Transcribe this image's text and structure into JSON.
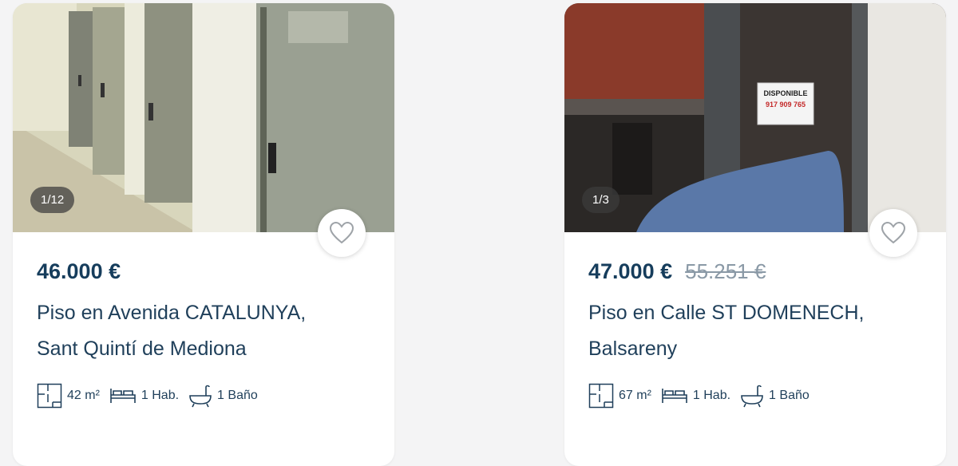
{
  "listings": [
    {
      "photo_counter": "1/12",
      "price": "46.000 €",
      "old_price": "",
      "title_line1": "Piso en Avenida CATALUNYA,",
      "title_line2": "Sant Quintí de Mediona",
      "area": "42 m²",
      "rooms": "1 Hab.",
      "baths": "1 Baño",
      "icons": [
        "floorplan-icon",
        "bed-icon",
        "bathtub-icon",
        "heart-icon"
      ]
    },
    {
      "photo_counter": "1/3",
      "price": "47.000 €",
      "old_price": "55.251 €",
      "title_line1": "Piso en Calle ST DOMENECH,",
      "title_line2": "Balsareny",
      "area": "67 m²",
      "rooms": "1 Hab.",
      "baths": "1 Baño",
      "sign_line1": "DISPONIBLE",
      "sign_line2": "917 909 765",
      "icons": [
        "floorplan-icon",
        "bed-icon",
        "bathtub-icon",
        "heart-icon"
      ]
    }
  ],
  "colors": {
    "price": "#163d5c",
    "text": "#1f3f5a",
    "strike": "#8a99a6",
    "background": "#f4f4f5"
  }
}
